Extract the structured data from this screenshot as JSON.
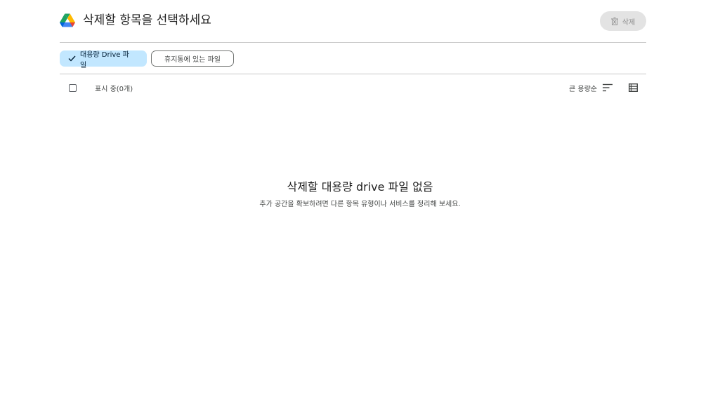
{
  "header": {
    "title": "삭제할 항목을 선택하세요",
    "delete_label": "삭제"
  },
  "filters": {
    "large_files_label": "대용량 Drive 파일",
    "trash_files_label": "휴지통에 있는 파일",
    "selected": "large_files"
  },
  "toolbar": {
    "showing_label": "표시 중(0개)",
    "sort_label": "큰 용량순"
  },
  "empty_state": {
    "title": "삭제할 대용량 drive 파일 없음",
    "subtitle": "추가 공간을 확보하려면 다른 항목 유형이나 서비스를 정리해 보세요."
  },
  "colors": {
    "chip_selected_bg": "#c2e7ff",
    "delete_button_bg": "#e3e3e3",
    "divider": "#c7c7c7"
  },
  "icons": [
    "google-drive-logo",
    "trash-icon",
    "check-icon",
    "checkbox",
    "sort-icon",
    "list-view-icon"
  ]
}
